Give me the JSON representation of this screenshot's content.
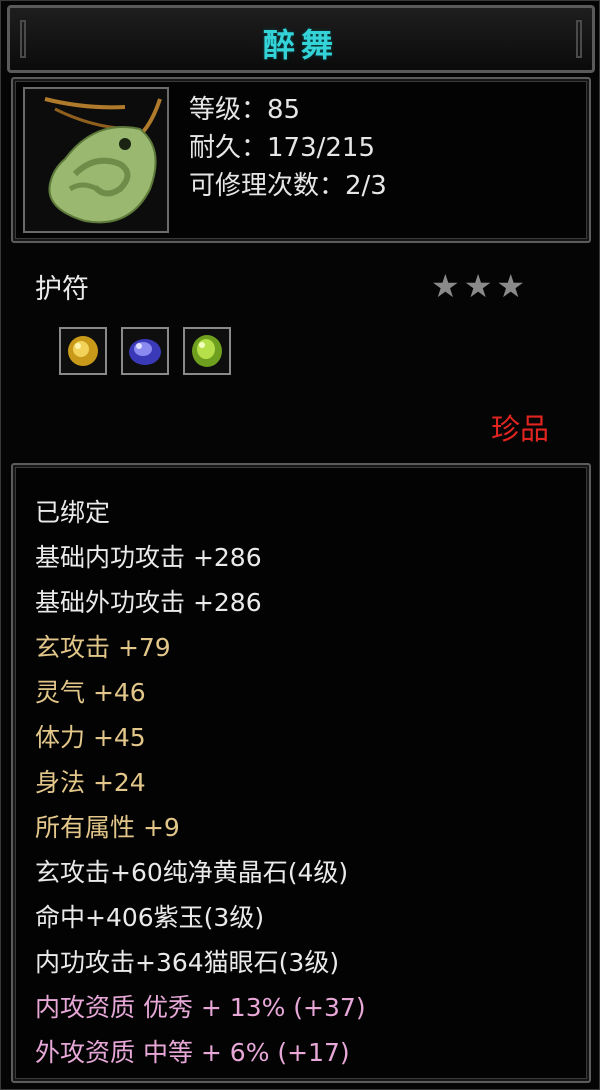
{
  "title": "醉舞",
  "item": {
    "icon": "jade-pendant-icon",
    "level": "等级：85",
    "durability": "耐久：173/215",
    "repair": "可修理次数：2/3"
  },
  "category": "护符",
  "stars": "★★★",
  "sockets": [
    "yellow-crystal-gem-icon",
    "purple-jade-gem-icon",
    "cats-eye-gem-icon"
  ],
  "rarity": "珍品",
  "colors": {
    "title": "#33d3d8",
    "white": "#eaeaea",
    "gold": "#e2c68a",
    "pink": "#e7a8d8",
    "rarity": "#e0241f"
  },
  "attributes": [
    {
      "text": "已绑定",
      "color": "white"
    },
    {
      "text": "基础内功攻击 +286",
      "color": "white"
    },
    {
      "text": "基础外功攻击 +286",
      "color": "white"
    },
    {
      "text": "玄攻击 +79",
      "color": "gold"
    },
    {
      "text": "灵气 +46",
      "color": "gold"
    },
    {
      "text": "体力 +45",
      "color": "gold"
    },
    {
      "text": "身法 +24",
      "color": "gold"
    },
    {
      "text": "所有属性 +9",
      "color": "gold"
    },
    {
      "text": "玄攻击+60纯净黄晶石(4级)",
      "color": "white"
    },
    {
      "text": "命中+406紫玉(3级)",
      "color": "white"
    },
    {
      "text": "内功攻击+364猫眼石(3级)",
      "color": "white"
    },
    {
      "text": "内攻资质 优秀 + 13% (+37)",
      "color": "pink"
    },
    {
      "text": "外攻资质 中等 + 6% (+17)",
      "color": "pink"
    }
  ]
}
